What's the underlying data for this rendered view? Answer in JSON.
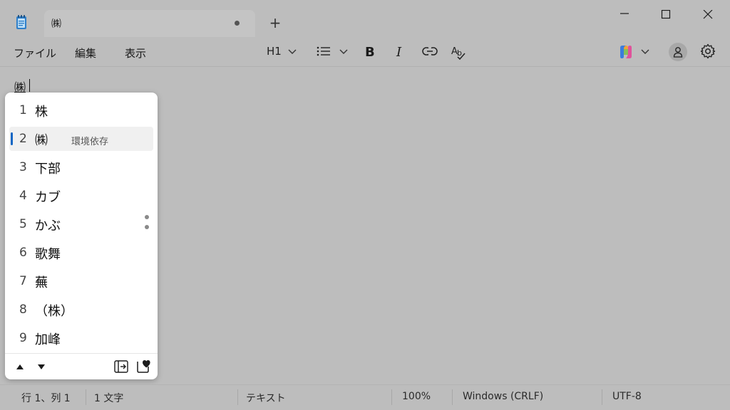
{
  "titlebar": {
    "tab_title": "㈱",
    "new_tab_label": "+"
  },
  "menu": {
    "file": "ファイル",
    "edit": "編集",
    "view": "表示"
  },
  "toolbar": {
    "heading_label": "H1",
    "bold_label": "B",
    "italic_label": "I"
  },
  "editor": {
    "text": "㈱"
  },
  "ime": {
    "candidates": [
      {
        "num": "1",
        "text": "株",
        "note": ""
      },
      {
        "num": "2",
        "text": "㈱",
        "note": "環境依存"
      },
      {
        "num": "3",
        "text": "下部",
        "note": ""
      },
      {
        "num": "4",
        "text": "カブ",
        "note": ""
      },
      {
        "num": "5",
        "text": "かぶ",
        "note": ""
      },
      {
        "num": "6",
        "text": "歌舞",
        "note": ""
      },
      {
        "num": "7",
        "text": "蕪",
        "note": ""
      },
      {
        "num": "8",
        "text": "（株）",
        "note": ""
      },
      {
        "num": "9",
        "text": "加峰",
        "note": ""
      }
    ],
    "selected_index": 1,
    "accent_color": "#1066c4"
  },
  "statusbar": {
    "position": "行 1、列 1",
    "char_count": "1 文字",
    "format": "テキスト",
    "zoom": "100%",
    "line_ending": "Windows (CRLF)",
    "encoding": "UTF-8"
  },
  "icons": {
    "app": "notepad-icon",
    "minimize": "minimize-icon",
    "maximize": "maximize-icon",
    "close": "close-icon",
    "list": "bullet-list-icon",
    "link": "link-icon",
    "spellcheck": "spellcheck-icon",
    "copilot": "copilot-icon",
    "account": "account-icon",
    "settings": "gear-icon"
  }
}
